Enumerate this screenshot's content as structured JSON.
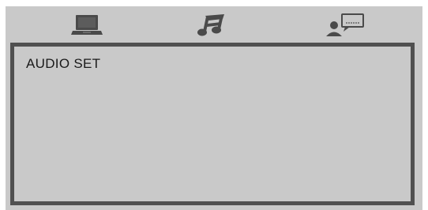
{
  "menu": {
    "tabs": [
      {
        "icon": "laptop-icon",
        "selected": false
      },
      {
        "icon": "music-note-icon",
        "selected": true
      },
      {
        "icon": "user-chat-icon",
        "selected": false
      }
    ],
    "colors": {
      "background": "#c9c9c9",
      "border": "#505050",
      "icon": "#4a4a4a"
    }
  },
  "panel": {
    "title": "AUDIO SET"
  }
}
